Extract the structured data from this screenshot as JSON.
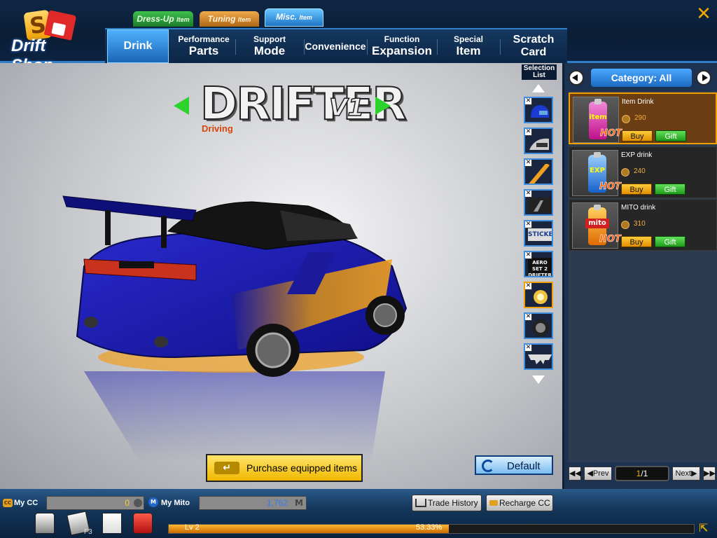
{
  "app": {
    "logo_text": "Drift Shop"
  },
  "top_tabs": [
    {
      "label": "Dress-Up",
      "sub": "Item"
    },
    {
      "label": "Tuning",
      "sub": "Item"
    },
    {
      "label": "Misc.",
      "sub": "Item"
    }
  ],
  "nav_tabs": [
    {
      "l1": "",
      "l2": "Drink"
    },
    {
      "l1": "Performance",
      "l2": "Parts"
    },
    {
      "l1": "Support",
      "l2": "Mode"
    },
    {
      "l1": "",
      "l2": "Convenience"
    },
    {
      "l1": "Function",
      "l2": "Expansion"
    },
    {
      "l1": "Special",
      "l2": "Item"
    },
    {
      "l1": "Scratch",
      "l2": "Card"
    }
  ],
  "preview": {
    "car_name": "DRIFTER",
    "car_version": "V1",
    "car_subtitle": "Driving",
    "selection_list_label": "Selection List",
    "purchase_label": "Purchase equipped items",
    "default_label": "Default"
  },
  "selection_slots": [
    {
      "icon": "helmet-icon"
    },
    {
      "icon": "mirror-icon"
    },
    {
      "icon": "neon-icon"
    },
    {
      "icon": "window-tint-icon"
    },
    {
      "icon": "sticker-icon",
      "text": "STICKER"
    },
    {
      "icon": "aero-set-icon",
      "text": "AERO SET 2 DRIFTER"
    },
    {
      "icon": "headlight-icon"
    },
    {
      "icon": "wheel-icon"
    },
    {
      "icon": "spoiler-icon"
    }
  ],
  "category": {
    "label": "Category: All"
  },
  "items": [
    {
      "name": "Item Drink",
      "price": "290",
      "bottle_text": "item",
      "hot": "HOT",
      "buy": "Buy",
      "gift": "Gift",
      "color": "#d82aa8"
    },
    {
      "name": "EXP drink",
      "price": "240",
      "bottle_text": "EXP",
      "hot": "HOT",
      "buy": "Buy",
      "gift": "Gift",
      "color": "#2a88e8"
    },
    {
      "name": "MITO drink",
      "price": "310",
      "bottle_text": "mito",
      "hot": "HOT",
      "buy": "Buy",
      "gift": "Gift",
      "color": "#f08a10"
    }
  ],
  "pager": {
    "prev": "Prev",
    "next": "Next",
    "current": "1",
    "total": "/1"
  },
  "wallet": {
    "cc_label": "My CC",
    "cc_icon": "CC",
    "cc_value": "0",
    "mito_label": "My Mito",
    "mito_icon": "M",
    "mito_value": "1,762",
    "mito_unit": "M"
  },
  "buttons": {
    "trade_history": "Trade History",
    "recharge_cc": "Recharge CC"
  },
  "status": {
    "level": "Lv 2",
    "xp_percent": "53.33%",
    "xp_fraction": 0.5333,
    "hotkey": "F3"
  }
}
